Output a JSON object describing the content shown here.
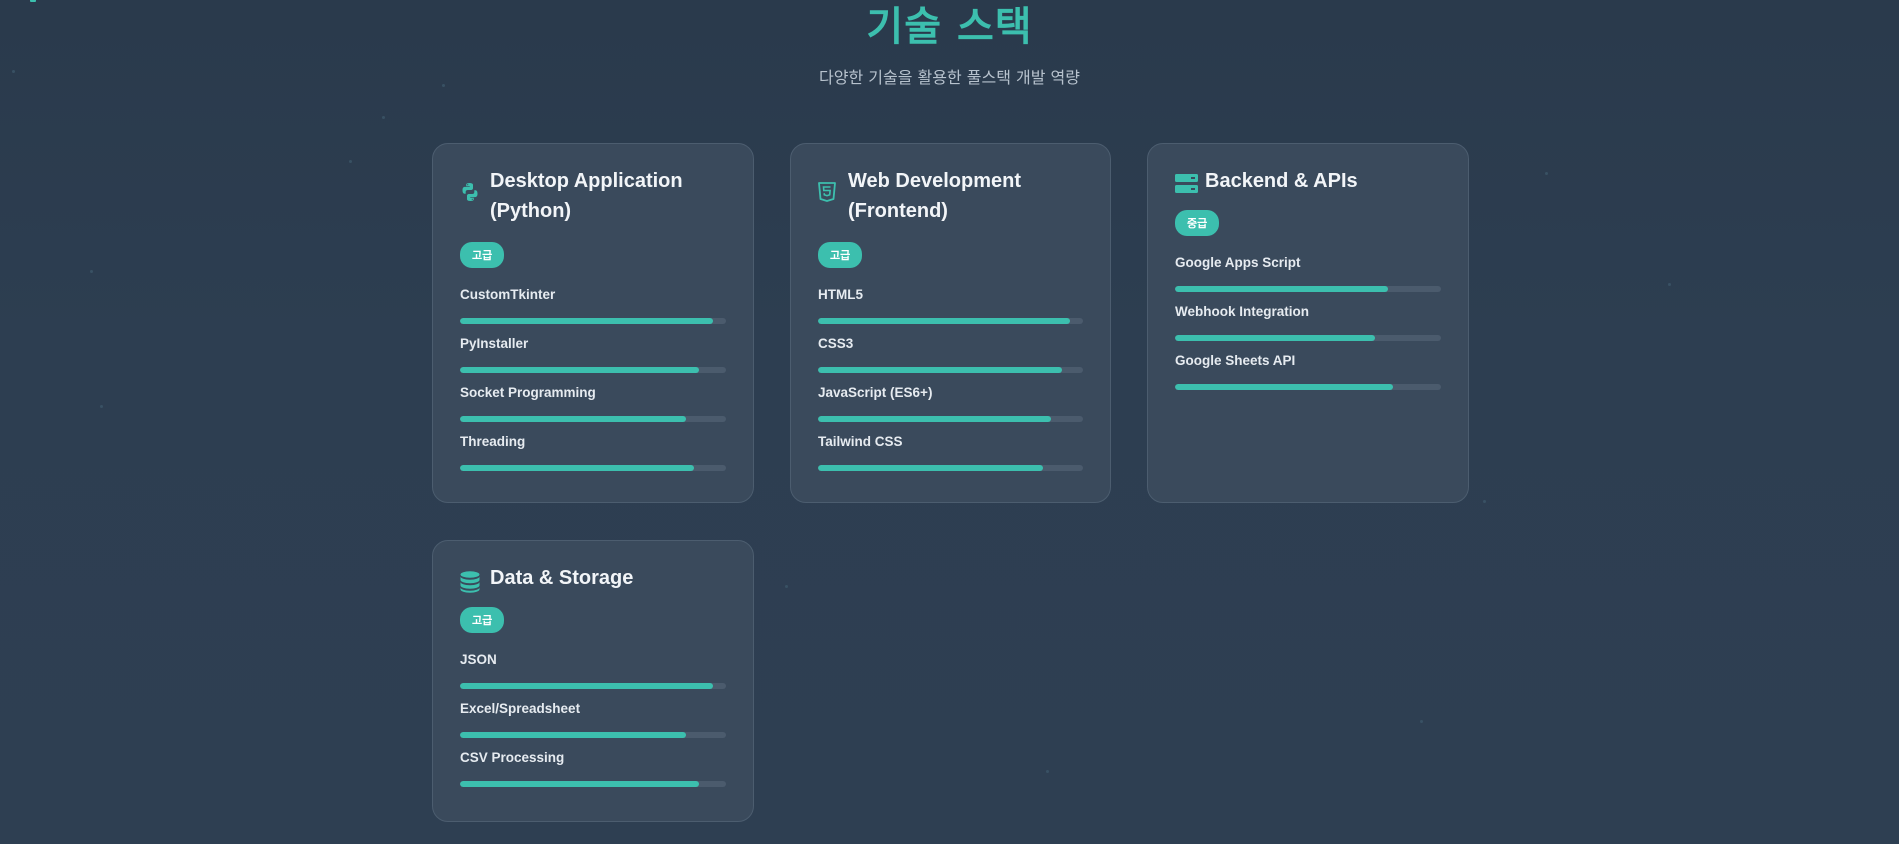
{
  "page": {
    "title": "기술 스택",
    "subtitle": "다양한 기술을 활용한 풀스택 개발 역량"
  },
  "colors": {
    "accent": "#3cbfae",
    "card": "#3a4a5c",
    "background": "#2d3e51"
  },
  "cards": [
    {
      "title": "Desktop Application (Python)",
      "icon": "python-icon",
      "badge": "고급",
      "skills": [
        {
          "name": "CustomTkinter",
          "level": 0.95
        },
        {
          "name": "PyInstaller",
          "level": 0.9
        },
        {
          "name": "Socket Programming",
          "level": 0.85
        },
        {
          "name": "Threading",
          "level": 0.88
        }
      ]
    },
    {
      "title": "Web Development (Frontend)",
      "icon": "html5-icon",
      "badge": "고급",
      "skills": [
        {
          "name": "HTML5",
          "level": 0.95
        },
        {
          "name": "CSS3",
          "level": 0.92
        },
        {
          "name": "JavaScript (ES6+)",
          "level": 0.88
        },
        {
          "name": "Tailwind CSS",
          "level": 0.85
        }
      ]
    },
    {
      "title": "Backend & APIs",
      "icon": "server-icon",
      "badge": "중급",
      "skills": [
        {
          "name": "Google Apps Script",
          "level": 0.8
        },
        {
          "name": "Webhook Integration",
          "level": 0.75
        },
        {
          "name": "Google Sheets API",
          "level": 0.82
        }
      ]
    },
    {
      "title": "Data & Storage",
      "icon": "database-icon",
      "badge": "고급",
      "skills": [
        {
          "name": "JSON",
          "level": 0.95
        },
        {
          "name": "Excel/Spreadsheet",
          "level": 0.85
        },
        {
          "name": "CSV Processing",
          "level": 0.9
        }
      ]
    }
  ]
}
